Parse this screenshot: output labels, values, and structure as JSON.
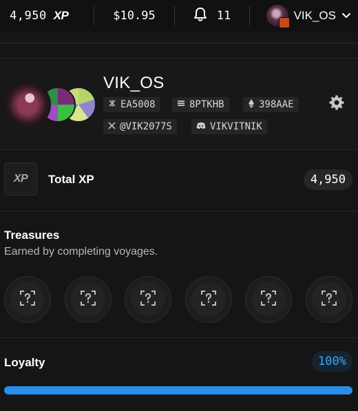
{
  "topbar": {
    "xp_value": "4,950",
    "xp_label": "XP",
    "balance": "$10.95",
    "notifications": "11",
    "username": "VIK_OS"
  },
  "profile": {
    "name": "VIK_OS",
    "chips": [
      {
        "icon": "solana-icon",
        "label": "EA5008"
      },
      {
        "icon": "stack-icon",
        "label": "8PTKHB"
      },
      {
        "icon": "ethereum-icon",
        "label": "398AAE"
      },
      {
        "icon": "x-twitter-icon",
        "label": "@VIK2077S"
      },
      {
        "icon": "discord-icon",
        "label": "VIKVITNIK"
      }
    ]
  },
  "xp": {
    "logo": "XP",
    "label": "Total XP",
    "value": "4,950"
  },
  "treasures": {
    "title": "Treasures",
    "subtitle": "Earned by completing voyages.",
    "slot_count": 6
  },
  "loyalty": {
    "title": "Loyalty",
    "percent_label": "100%",
    "progress": 1.0
  },
  "colors": {
    "background": "#151515",
    "accent_blue": "#2a8fea",
    "percent_text": "#3ba4ff"
  }
}
